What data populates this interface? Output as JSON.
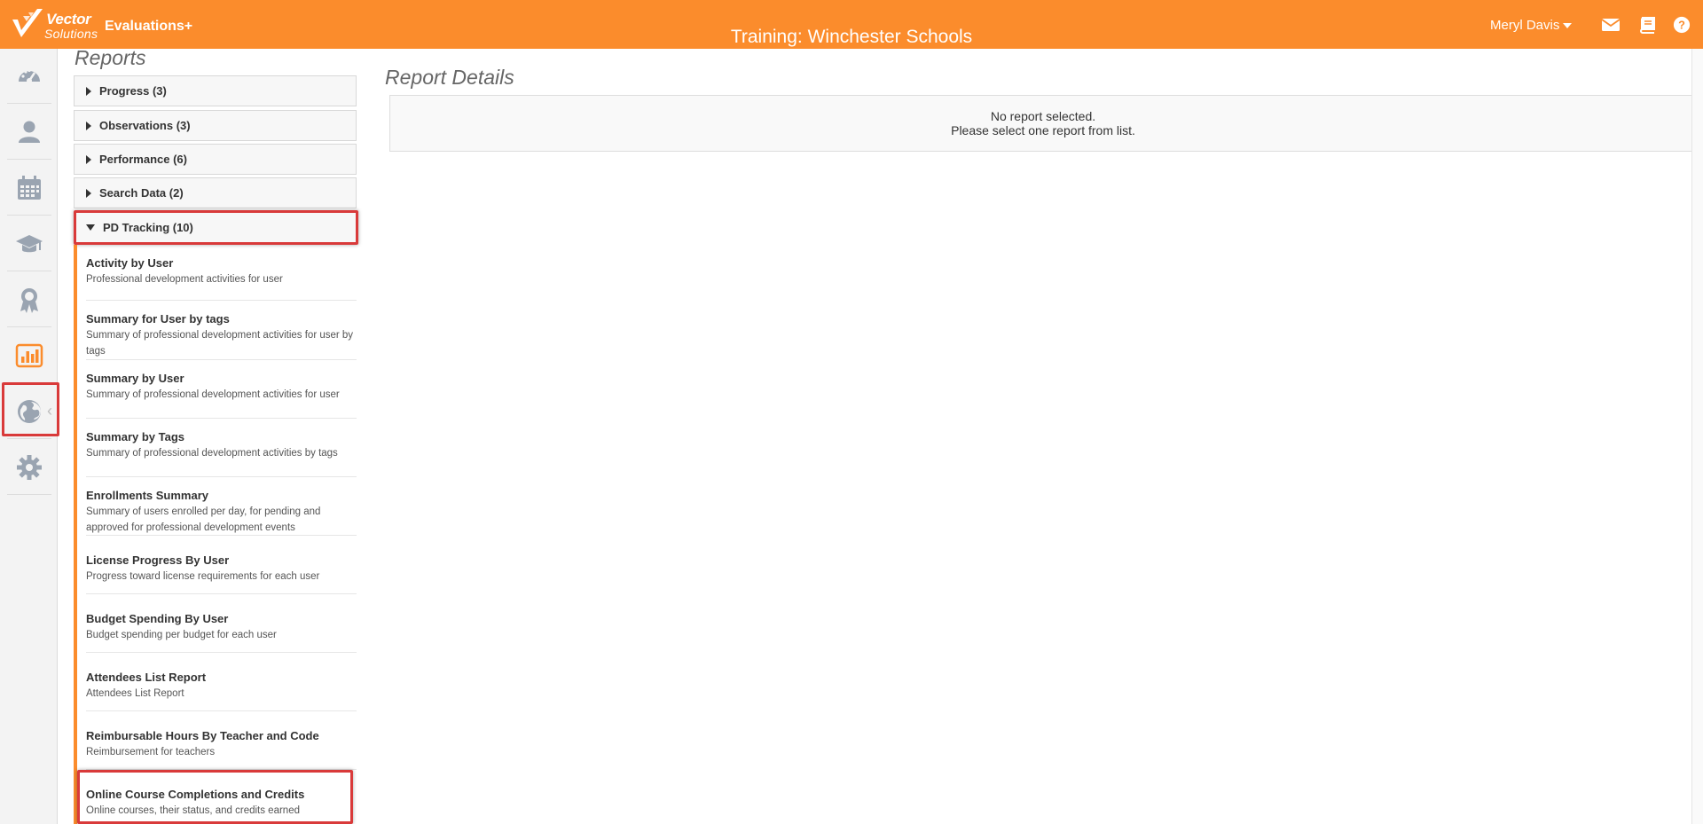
{
  "header": {
    "logo_line1": "Vector",
    "logo_line2": "Solutions",
    "app_name": "Evaluations+",
    "center_title": "Training: Winchester Schools",
    "user_name": "Meryl Davis",
    "accent_color": "#fb8c2c"
  },
  "rail": {
    "items": [
      "dashboard-icon",
      "user-icon",
      "calendar-icon",
      "graduation-cap-icon",
      "award-icon",
      "bar-chart-icon",
      "globe-icon",
      "gear-icon"
    ],
    "active": "bar-chart-icon"
  },
  "reports": {
    "title": "Reports",
    "categories": [
      {
        "label": "Progress (3)",
        "expanded": false
      },
      {
        "label": "Observations (3)",
        "expanded": false
      },
      {
        "label": "Performance (6)",
        "expanded": false
      },
      {
        "label": "Search Data (2)",
        "expanded": false
      },
      {
        "label": "PD Tracking (10)",
        "expanded": true
      }
    ],
    "items": [
      {
        "name": "Activity by User",
        "desc": "Professional development activities for user"
      },
      {
        "name": "Summary for User by tags",
        "desc": "Summary of professional development activities for user by tags"
      },
      {
        "name": "Summary by User",
        "desc": "Summary of professional development activities for user"
      },
      {
        "name": "Summary by Tags",
        "desc": "Summary of professional development activities by tags"
      },
      {
        "name": "Enrollments Summary",
        "desc": "Summary of users enrolled per day, for pending and approved for professional development events"
      },
      {
        "name": "License Progress By User",
        "desc": "Progress toward license requirements for each user"
      },
      {
        "name": "Budget Spending By User",
        "desc": "Budget spending per budget for each user"
      },
      {
        "name": "Attendees List Report",
        "desc": "Attendees List Report"
      },
      {
        "name": "Reimbursable Hours By Teacher and Code",
        "desc": "Reimbursement for teachers"
      },
      {
        "name": "Online Course Completions and Credits",
        "desc": "Online courses, their status, and credits earned"
      }
    ]
  },
  "details": {
    "title": "Report Details",
    "empty_line1": "No report selected.",
    "empty_line2": "Please select one report from list."
  }
}
